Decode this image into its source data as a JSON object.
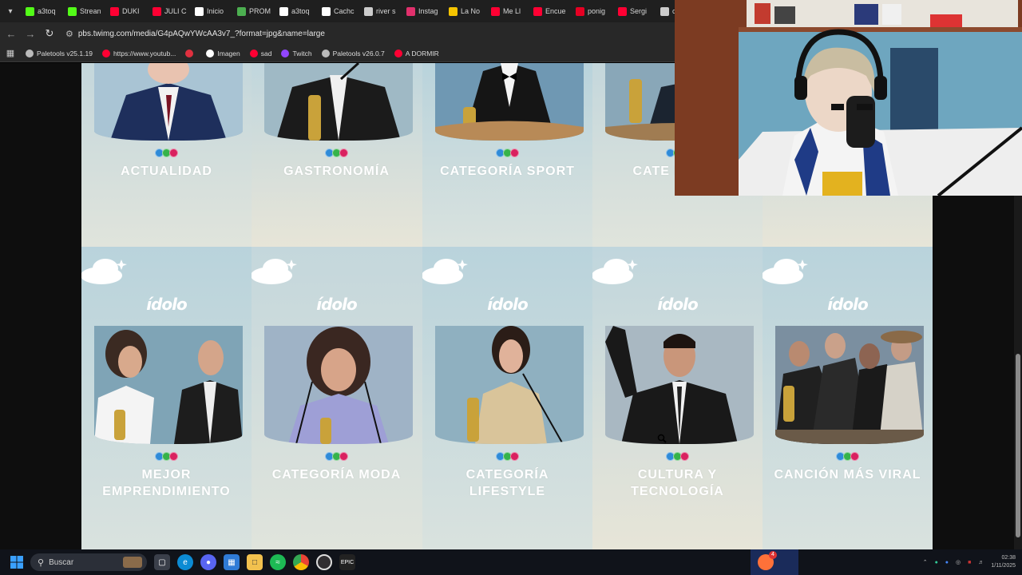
{
  "browser": {
    "tabs": [
      {
        "label": "a3toq",
        "color": "#53fc18"
      },
      {
        "label": "Strean",
        "color": "#53fc18"
      },
      {
        "label": "DUKI",
        "color": "#ff0033"
      },
      {
        "label": "JULI C",
        "color": "#ff0033"
      },
      {
        "label": "Inicio",
        "color": "#ffffff"
      },
      {
        "label": "PROM",
        "color": "#4caf50"
      },
      {
        "label": "a3toq",
        "color": "#ffffff"
      },
      {
        "label": "Cachc",
        "color": "#ffffff"
      },
      {
        "label": "river s",
        "color": "#cccccc"
      },
      {
        "label": "Instag",
        "color": "#e1306c"
      },
      {
        "label": "La No",
        "color": "#f5c400"
      },
      {
        "label": "Me Ll",
        "color": "#ff0033"
      },
      {
        "label": "Encue",
        "color": "#ff0033"
      },
      {
        "label": "ponig",
        "color": "#e60023"
      },
      {
        "label": "Sergi",
        "color": "#ff0033"
      },
      {
        "label": "cc",
        "color": "#cccccc"
      }
    ],
    "url": "pbs.twimg.com/media/G4pAQwYWcAA3v7_?format=jpg&name=large",
    "bookmarks": [
      {
        "label": "Paletools v25.1.19",
        "color": "#bbbbbb"
      },
      {
        "label": "https://www.youtub...",
        "color": "#ff0033"
      },
      {
        "label": "",
        "color": "#e0303f"
      },
      {
        "label": "Imagen",
        "color": "#ffffff"
      },
      {
        "label": "sad",
        "color": "#ff0033"
      },
      {
        "label": "Twitch",
        "color": "#9146ff"
      },
      {
        "label": "Paletools v26.0.7",
        "color": "#bbbbbb"
      },
      {
        "label": "A DORMIR",
        "color": "#ff0033"
      }
    ]
  },
  "poster": {
    "logo": "ídolo",
    "top_row": [
      {
        "category": "ACTUALIDAD"
      },
      {
        "category": "GASTRONOMÍA"
      },
      {
        "category": "CATEGORÍA SPORT"
      },
      {
        "category": "CATE FUTBO"
      }
    ],
    "bottom_row": [
      {
        "category": "MEJOR EMPRENDIMIENTO"
      },
      {
        "category": "CATEGORÍA MODA"
      },
      {
        "category": "CATEGORÍA LIFESTYLE"
      },
      {
        "category": "CULTURA Y TECNOLOGÍA"
      },
      {
        "category": "CANCIÓN MÁS VIRAL"
      }
    ],
    "brand_colors": [
      "#2f8bd8",
      "#36b34a",
      "#d9215f"
    ]
  },
  "taskbar": {
    "search_placeholder": "Buscar",
    "time": "02:38",
    "date": "1/11/2025",
    "notification_count": "4"
  }
}
